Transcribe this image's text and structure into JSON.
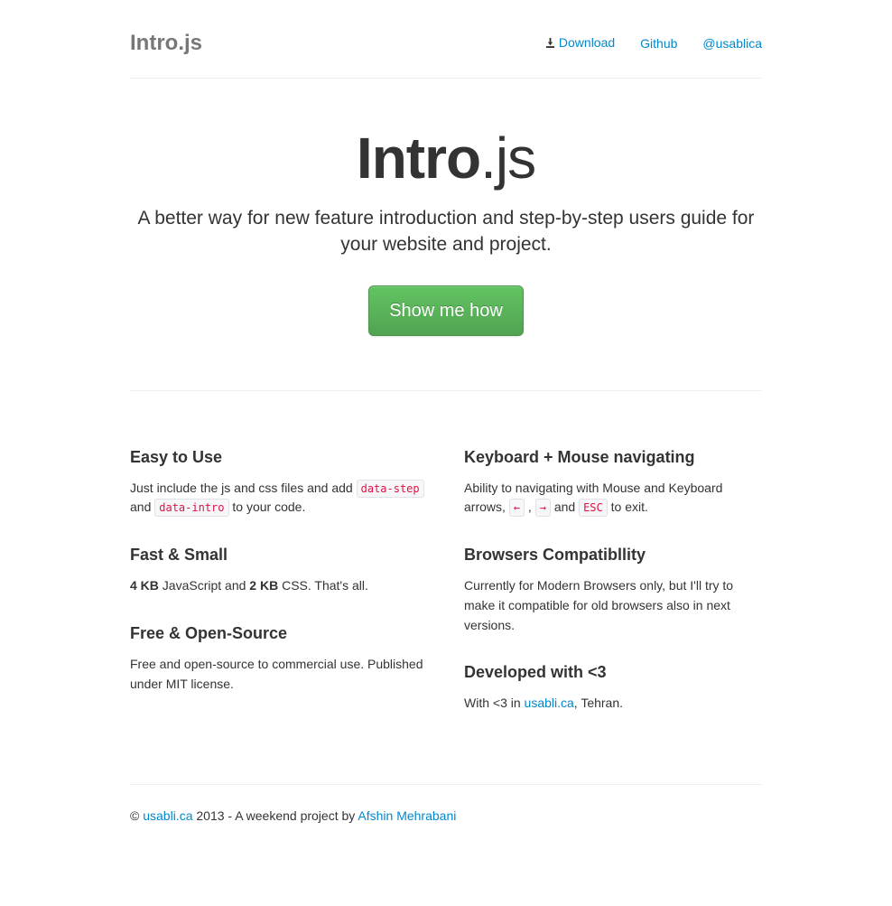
{
  "header": {
    "brand": "Intro.js",
    "nav": {
      "download": "Download",
      "github": "Github",
      "twitter": "@usablica"
    }
  },
  "hero": {
    "title_bold": "Intro",
    "title_rest": ".js",
    "tagline": "A better way for new feature introduction and step-by-step users guide for your website and project.",
    "cta": "Show me how"
  },
  "features": {
    "left": [
      {
        "title": "Easy to Use",
        "before": "Just include the js and css files and add ",
        "code1": "data-step",
        "mid": " and ",
        "code2": "data-intro",
        "after": " to your code."
      },
      {
        "title": "Fast & Small",
        "b1": "4 KB",
        "t1": " JavaScript and ",
        "b2": "2 KB",
        "t2": " CSS. That's all."
      },
      {
        "title": "Free & Open-Source",
        "text": "Free and open-source to commercial use. Published under MIT license."
      }
    ],
    "right": [
      {
        "title": "Keyboard + Mouse navigating",
        "before": "Ability to navigating with Mouse and Keyboard arrows, ",
        "code1": "←",
        "mid1": " , ",
        "code2": "→",
        "mid2": " and ",
        "code3": "ESC",
        "after": " to exit."
      },
      {
        "title": "Browsers Compatibllity",
        "text": "Currently for Modern Browsers only, but I'll try to make it compatible for old browsers also in next versions."
      },
      {
        "title": "Developed with <3",
        "before": "With <3 in ",
        "link": "usabli.ca",
        "after": ", Tehran."
      }
    ]
  },
  "footer": {
    "copy": "© ",
    "link1": "usabli.ca",
    "mid": " 2013 - A weekend project by ",
    "link2": "Afshin Mehrabani"
  }
}
